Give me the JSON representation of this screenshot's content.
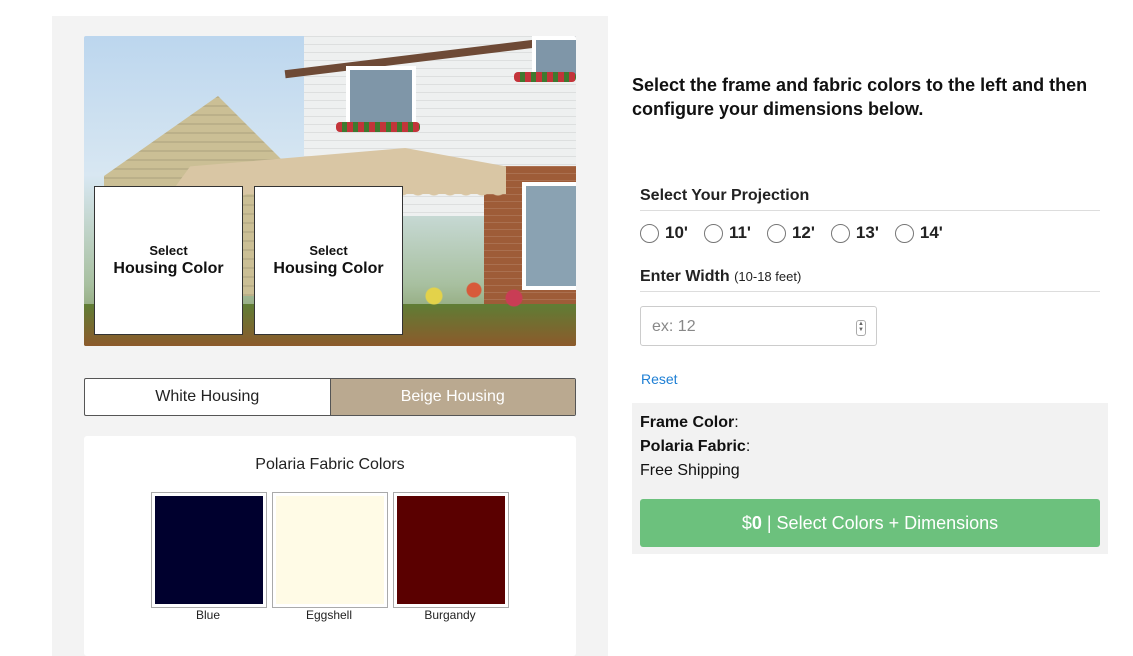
{
  "preview": {
    "box1_small": "Select",
    "box1_big": "Housing Color",
    "box2_small": "Select",
    "box2_big": "Housing Color"
  },
  "housing": {
    "options": [
      "White Housing",
      "Beige Housing"
    ],
    "selected": "Beige Housing",
    "selected_color": "#baa990"
  },
  "fabric": {
    "title": "Polaria Fabric Colors",
    "swatches": [
      {
        "name": "Blue",
        "color": "#00002e"
      },
      {
        "name": "Eggshell",
        "color": "#fffbe6"
      },
      {
        "name": "Burgandy",
        "color": "#5a0000"
      }
    ]
  },
  "intro": "Select the frame and fabric colors to the left and then configure your dimensions below.",
  "projection": {
    "label": "Select Your Projection",
    "options": [
      "10'",
      "11'",
      "12'",
      "13'",
      "14'"
    ]
  },
  "width": {
    "label": "Enter Width",
    "hint": "(10-18 feet)",
    "placeholder": "ex: 12",
    "value": ""
  },
  "reset_label": "Reset",
  "summary": {
    "frame_label": "Frame Color",
    "fabric_label": "Polaria Fabric",
    "colon": ":",
    "shipping": "Free Shipping"
  },
  "cta": {
    "currency": "$",
    "price": "0",
    "text": " | Select Colors + Dimensions",
    "color": "#6cc17d"
  }
}
